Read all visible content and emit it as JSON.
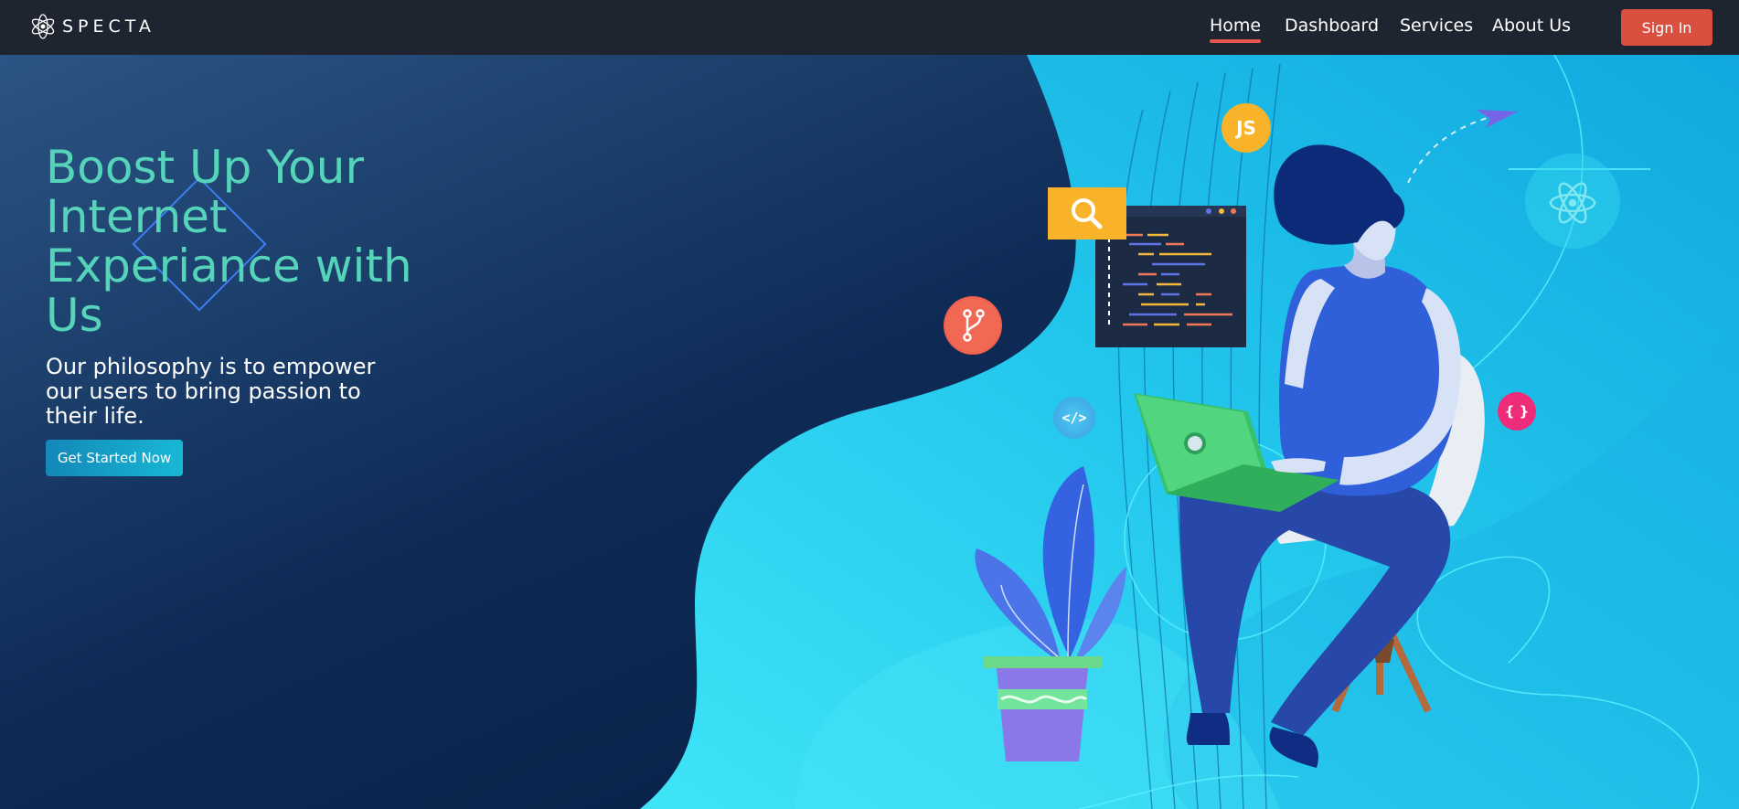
{
  "brand": {
    "name": "SPECTA"
  },
  "nav": {
    "items": [
      {
        "label": "Home",
        "active": true
      },
      {
        "label": "Dashboard",
        "active": false
      },
      {
        "label": "Services",
        "active": false
      },
      {
        "label": "About Us",
        "active": false
      }
    ],
    "signin_label": "Sign In"
  },
  "hero": {
    "headline": "Boost Up Your Internet Experiance with Us",
    "subheadline": "Our philosophy is to empower our users to bring passion to their life.",
    "cta_label": "Get Started Now"
  },
  "illustration": {
    "js_badge": "JS",
    "code_badge": "</>",
    "braces_badge": "{ }"
  },
  "colors": {
    "nav_bg": "#1f2530",
    "accent": "#e5574b",
    "signin_bg": "#d9503f",
    "headline": "#55d4b9",
    "hero_dark": "#0b2247",
    "hero_light": "#2fd1ee"
  },
  "icons": [
    "specta-atom-logo-icon",
    "search-icon",
    "git-branch-icon",
    "js-icon",
    "code-icon",
    "braces-icon",
    "react-atom-icon",
    "paper-plane-icon"
  ]
}
